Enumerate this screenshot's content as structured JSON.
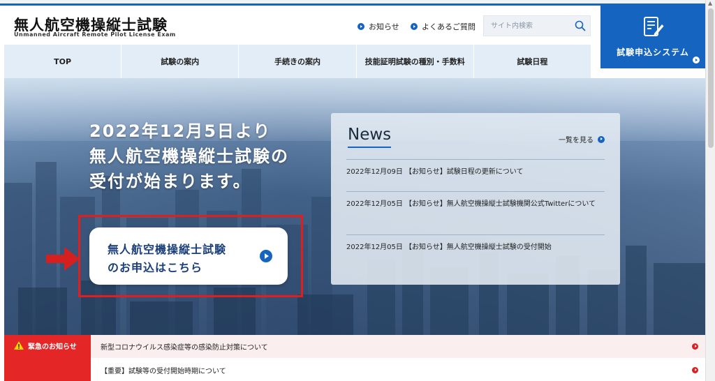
{
  "header": {
    "logo_title": "無人航空機操縦士試験",
    "logo_subtitle": "Unmanned Aircraft Remote Pilot License Exam",
    "links": [
      {
        "label": "お知らせ"
      },
      {
        "label": "よくあるご質問"
      }
    ],
    "search": {
      "placeholder": "サイト内検索"
    },
    "apply": {
      "label": "試験申込システム"
    }
  },
  "nav": {
    "items": [
      {
        "label": "TOP"
      },
      {
        "label": "試験の案内"
      },
      {
        "label": "手続きの案内"
      },
      {
        "label": "技能証明試験の種別・手数料"
      },
      {
        "label": "試験日程"
      }
    ]
  },
  "hero": {
    "headline": [
      "2022年12月5日より",
      "無人航空機操縦士試験の",
      "受付が始まります。"
    ],
    "cta": {
      "line1": "無人航空機操縦士試験",
      "line2": "のお申込はこちら"
    }
  },
  "news": {
    "title": "News",
    "more_label": "一覧を見る",
    "items": [
      {
        "date": "2022年12月09日",
        "text": "【お知らせ】試験日程の更新について"
      },
      {
        "date": "2022年12月05日",
        "text": "【お知らせ】無人航空機操縦士試験機関公式Twitterについて"
      },
      {
        "date": "2022年12月05日",
        "text": "【お知らせ】無人航空機操縦士試験の受付開始"
      }
    ]
  },
  "alerts": {
    "label": "緊急のお知らせ",
    "items": [
      {
        "text": "新型コロナウイルス感染症等の感染防止対策について"
      },
      {
        "text": "【重要】試験等の受付開始時期について"
      }
    ]
  },
  "colors": {
    "brand_blue": "#1565c0",
    "alert_red": "#e52626",
    "nav_bg": "#e3edf7"
  }
}
